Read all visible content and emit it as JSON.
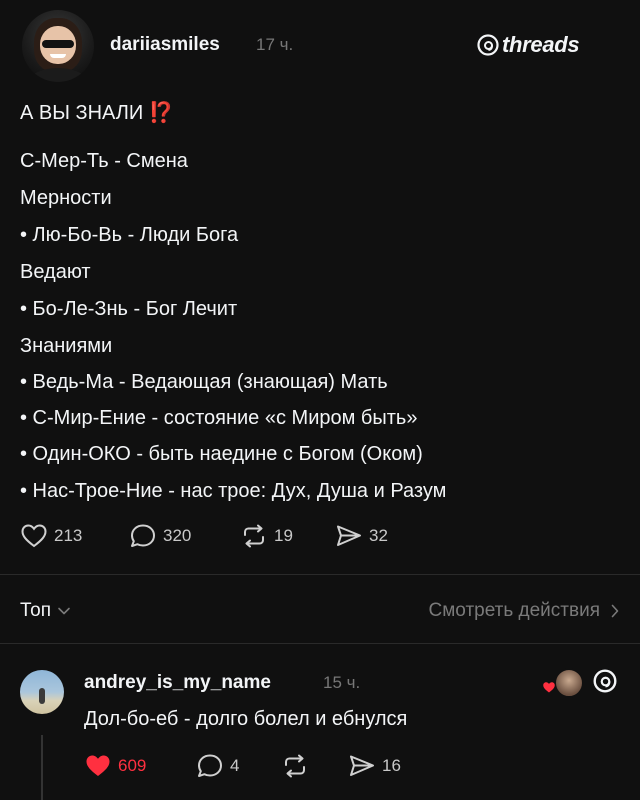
{
  "post": {
    "author": "dariiasmiles",
    "time": "17 ч.",
    "brand": "threads",
    "lines": [
      {
        "text": "А ВЫ ЗНАЛИ ",
        "emoji": "⁉️"
      },
      {
        "text": "С-Мер-Ть -  Смена"
      },
      {
        "text": "Мерности"
      },
      {
        "text": "• Лю-Бо-Вь - Люди Бога"
      },
      {
        "text": "Ведают"
      },
      {
        "text": "• Бо-Ле-Знь - Бог Лечит"
      },
      {
        "text": "Знаниями"
      },
      {
        "text": "• Ведь-Ма - Ведающая (знающая) Мать"
      },
      {
        "text": "• С-Мир-Ение - состояние «с Миром быть»"
      },
      {
        "text": "• Один-ОКО - быть наедине с Богом (Оком)"
      },
      {
        "text": "• Нас-Трое-Ние - нас трое: Дух, Душа и Разум"
      }
    ],
    "stats": {
      "likes": "213",
      "comments": "320",
      "reposts": "19",
      "shares": "32"
    }
  },
  "tabs": {
    "left_label": "Топ",
    "right_label": "Смотреть действия"
  },
  "reply": {
    "author": "andrey_is_my_name",
    "time": "15 ч.",
    "text": "Дол-бо-еб - долго болел и ебнулся",
    "stats": {
      "likes": "609",
      "comments": "4",
      "shares": "16"
    }
  },
  "colors": {
    "background": "#101010",
    "text": "#f3f5f7",
    "muted": "#777777",
    "like_red": "#ff3040"
  },
  "icons": [
    "heart-icon",
    "comment-icon",
    "repost-icon",
    "share-icon",
    "chevron-down-icon",
    "chevron-right-icon",
    "threads-logo-icon"
  ]
}
